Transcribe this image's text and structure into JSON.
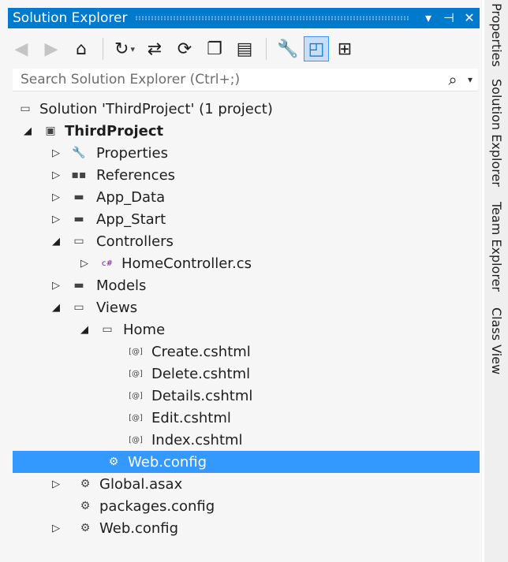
{
  "title_bar": {
    "title": "Solution Explorer",
    "dropdown_glyph": "▾",
    "pin_glyph": "⊣",
    "close_glyph": "✕"
  },
  "toolbar": {
    "back": "◀",
    "forward": "▶",
    "home": "⌂",
    "history": "↻",
    "dropdown": "▾",
    "sync": "⇄",
    "refresh": "⟳",
    "collapse_all": "❐",
    "show_all_files": "▤",
    "properties": "🔧",
    "preview": "◰",
    "view_class_diagram": "⊞"
  },
  "search": {
    "placeholder": "Search Solution Explorer (Ctrl+;)",
    "icon": "⌕",
    "dropdown": "▾"
  },
  "tree": {
    "rows": [
      {
        "label": "Solution 'ThirdProject' (1 project)",
        "icon": "▭",
        "expander": ""
      },
      {
        "label": "ThirdProject",
        "icon": "▣",
        "expander": "◢"
      },
      {
        "label": "Properties",
        "icon": "🔧",
        "expander": "▷"
      },
      {
        "label": "References",
        "icon": "▪▪",
        "expander": "▷"
      },
      {
        "label": "App_Data",
        "icon": "▬",
        "expander": "▷"
      },
      {
        "label": "App_Start",
        "icon": "▬",
        "expander": "▷"
      },
      {
        "label": "Controllers",
        "icon": "▭",
        "expander": "◢"
      },
      {
        "label": "HomeController.cs",
        "icon": "c#",
        "expander": "▷"
      },
      {
        "label": "Models",
        "icon": "▬",
        "expander": "▷"
      },
      {
        "label": "Views",
        "icon": "▭",
        "expander": "◢"
      },
      {
        "label": "Home",
        "icon": "▭",
        "expander": "◢"
      },
      {
        "label": "Create.cshtml",
        "icon": "[@]",
        "expander": ""
      },
      {
        "label": "Delete.cshtml",
        "icon": "[@]",
        "expander": ""
      },
      {
        "label": "Details.cshtml",
        "icon": "[@]",
        "expander": ""
      },
      {
        "label": "Edit.cshtml",
        "icon": "[@]",
        "expander": ""
      },
      {
        "label": "Index.cshtml",
        "icon": "[@]",
        "expander": ""
      },
      {
        "label": "Web.config",
        "icon": "⚙",
        "expander": ""
      },
      {
        "label": "Global.asax",
        "icon": "⚙",
        "expander": "▷"
      },
      {
        "label": "packages.config",
        "icon": "⚙",
        "expander": ""
      },
      {
        "label": "Web.config",
        "icon": "⚙",
        "expander": "▷"
      }
    ]
  },
  "side_tabs": {
    "properties": "Properties",
    "solution_explorer": "Solution Explorer",
    "team_explorer": "Team Explorer",
    "class_view": "Class View"
  },
  "colors": {
    "accent": "#007acc",
    "selection": "#3399ff",
    "panel_bg": "#f6f6f6"
  }
}
